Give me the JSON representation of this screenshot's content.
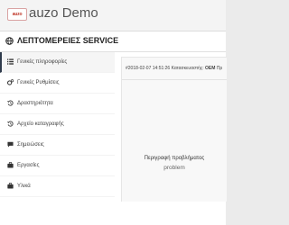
{
  "header": {
    "logo_text": "auzo",
    "title": "auzo Demo"
  },
  "panel": {
    "title": "ΛΕΠΤΟΜΕΡΕΙΕΣ SERVICE",
    "title_icon": "globe-icon"
  },
  "sidebar": {
    "items": [
      {
        "label": "Γενικές πληροφορίες",
        "icon": "list-icon",
        "active": true
      },
      {
        "label": "Γενικές Ρυθμίσεις",
        "icon": "gears-icon",
        "active": false
      },
      {
        "label": "Δραστηριότητα",
        "icon": "history-icon",
        "active": false
      },
      {
        "label": "Αρχείο καταγραφής",
        "icon": "history-icon",
        "active": false
      },
      {
        "label": "Σημειώσεις",
        "icon": "comment-icon",
        "active": false
      },
      {
        "label": "Εργασίες",
        "icon": "briefcase-icon",
        "active": false
      },
      {
        "label": "Υλικά",
        "icon": "briefcase-icon",
        "active": false
      }
    ]
  },
  "detail": {
    "record_prefix": "#2018-02-07 14:51:26 Κατασκευαστής:",
    "record_bold": "OEM",
    "record_suffix": "Πρ",
    "description_label": "Περιγραφή προβλήματος",
    "description_value": "problem"
  },
  "colors": {
    "active_border": "#2f3b4c",
    "logo_red": "#c0392b"
  }
}
